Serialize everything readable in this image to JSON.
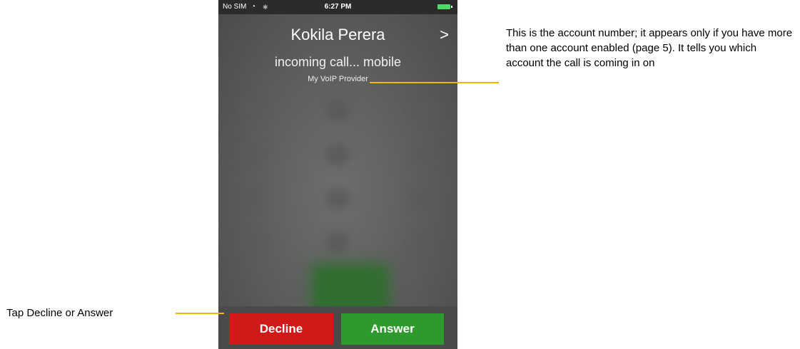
{
  "status_bar": {
    "carrier": "No SIM",
    "wifi_icon": "wifi-icon",
    "time": "6:27 PM",
    "battery_icon": "battery-icon"
  },
  "call": {
    "caller_name": "Kokila Perera",
    "status": "incoming call... mobile",
    "account": "My VoIP Provider"
  },
  "buttons": {
    "decline": "Decline",
    "answer": "Answer"
  },
  "annotations": {
    "account_note": "This is the account number; it appears only if you have more than one account enabled (page 5). It tells you which account the call is coming in on",
    "buttons_note": "Tap Decline or Answer"
  },
  "colors": {
    "decline": "#d21919",
    "answer": "#2e9a2e",
    "callout": "#f2b705"
  }
}
